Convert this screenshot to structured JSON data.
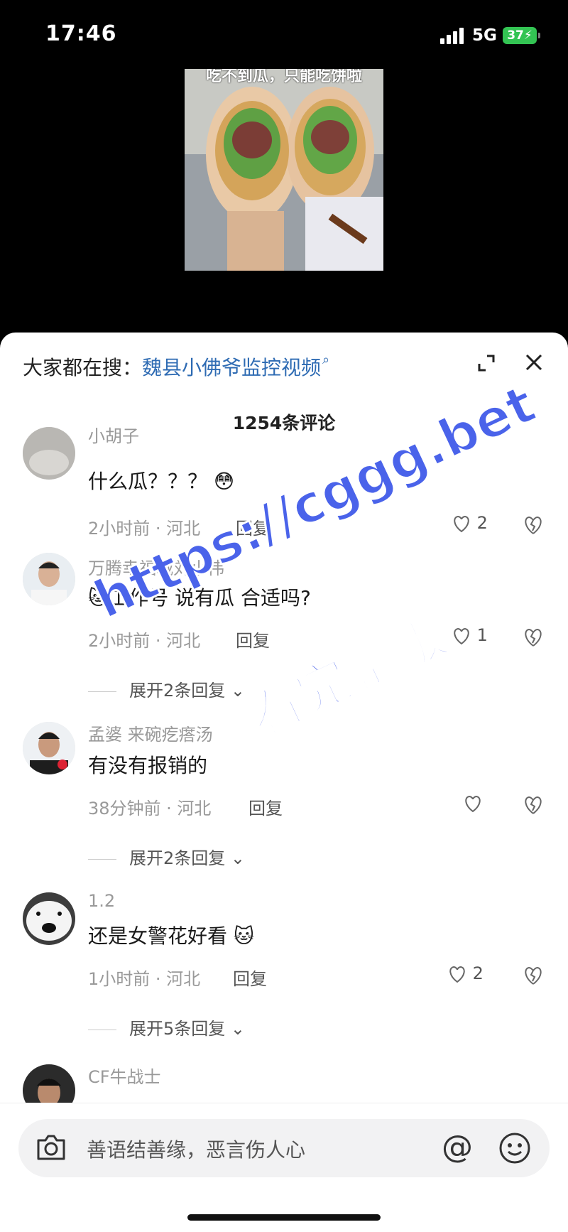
{
  "status": {
    "time": "17:46",
    "network": "5G",
    "battery": "37"
  },
  "video": {
    "caption": "吃不到瓜，只能吃饼啦"
  },
  "sheet": {
    "search_prefix": "大家都在搜：",
    "search_link": "魏县小佛爷监控视频",
    "comment_count": "1254条评论"
  },
  "comments": [
    {
      "user": "小胡子",
      "text": "什么瓜？？？",
      "time": "2小时前 · 河北",
      "reply": "回复",
      "likes": "2",
      "expand": ""
    },
    {
      "user": "万腾幸福城刘小伟",
      "text": "工作号  说有瓜  合适吗?",
      "time": "2小时前 · 河北",
      "reply": "回复",
      "likes": "1",
      "expand": "展开2条回复"
    },
    {
      "user": "孟婆 来碗疙瘩汤",
      "text": "有没有报销的",
      "time": "38分钟前 · 河北",
      "reply": "回复",
      "likes": "",
      "expand": "展开2条回复"
    },
    {
      "user": "1.2",
      "text": "还是女警花好看",
      "time": "1小时前 · 河北",
      "reply": "回复",
      "likes": "2",
      "expand": "展开5条回复"
    },
    {
      "user": "CF牛战士",
      "text": "",
      "time": "",
      "reply": "",
      "likes": "",
      "expand": ""
    }
  ],
  "input": {
    "placeholder": "善语结善缘，恶言伤人心"
  },
  "watermark": {
    "line1": "https://cggg.bet",
    "line2": "看完整版"
  },
  "colors": {
    "link": "#2e6bb3",
    "watermark": "#4a63ea",
    "battery": "#33c453"
  },
  "icons": [
    "search-icon",
    "expand-icon",
    "close-icon",
    "heart-icon",
    "dislike-icon",
    "camera-icon",
    "at-icon",
    "emoji-icon"
  ]
}
